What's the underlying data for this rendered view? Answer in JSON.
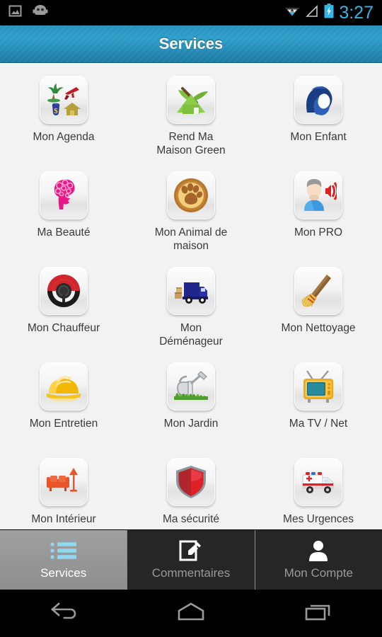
{
  "status_bar": {
    "icons": [
      "image-icon",
      "android-robot-icon",
      "wifi-icon",
      "signal-icon",
      "battery-charging-icon"
    ],
    "time": "3:27",
    "clock_color": "#33b5e5"
  },
  "header": {
    "title": "Services",
    "background_color": "#2a93bd",
    "text_color": "#ffffff"
  },
  "services": [
    {
      "label": "Mon Agenda",
      "icon": "agenda-icon"
    },
    {
      "label": "Rend Ma\nMaison Green",
      "icon": "green-house-icon"
    },
    {
      "label": "Mon Enfant",
      "icon": "mother-child-icon"
    },
    {
      "label": "Ma Beauté",
      "icon": "beauty-woman-icon"
    },
    {
      "label": "Mon Animal de\nmaison",
      "icon": "paw-print-icon"
    },
    {
      "label": "Mon PRO",
      "icon": "person-speaking-icon"
    },
    {
      "label": "Mon Chauffeur",
      "icon": "steering-wheel-icon"
    },
    {
      "label": "Mon\nDéménageur",
      "icon": "moving-truck-icon"
    },
    {
      "label": "Mon Nettoyage",
      "icon": "broom-icon"
    },
    {
      "label": "Mon Entretien",
      "icon": "hard-hat-icon"
    },
    {
      "label": "Mon Jardin",
      "icon": "watering-can-icon"
    },
    {
      "label": "Ma TV / Net",
      "icon": "television-icon"
    },
    {
      "label": "Mon Intérieur",
      "icon": "sofa-lamp-icon"
    },
    {
      "label": "Ma sécurité",
      "icon": "shield-icon"
    },
    {
      "label": "Mes Urgences",
      "icon": "ambulance-icon"
    }
  ],
  "tabs": [
    {
      "label": "Services",
      "icon": "list-icon",
      "active": true
    },
    {
      "label": "Commentaires",
      "icon": "compose-icon",
      "active": false
    },
    {
      "label": "Mon Compte",
      "icon": "person-icon",
      "active": false
    }
  ],
  "nav_bar": {
    "buttons": [
      {
        "name": "back-button",
        "icon": "back-arrow-icon"
      },
      {
        "name": "home-button",
        "icon": "home-icon"
      },
      {
        "name": "recents-button",
        "icon": "recents-icon"
      }
    ]
  }
}
